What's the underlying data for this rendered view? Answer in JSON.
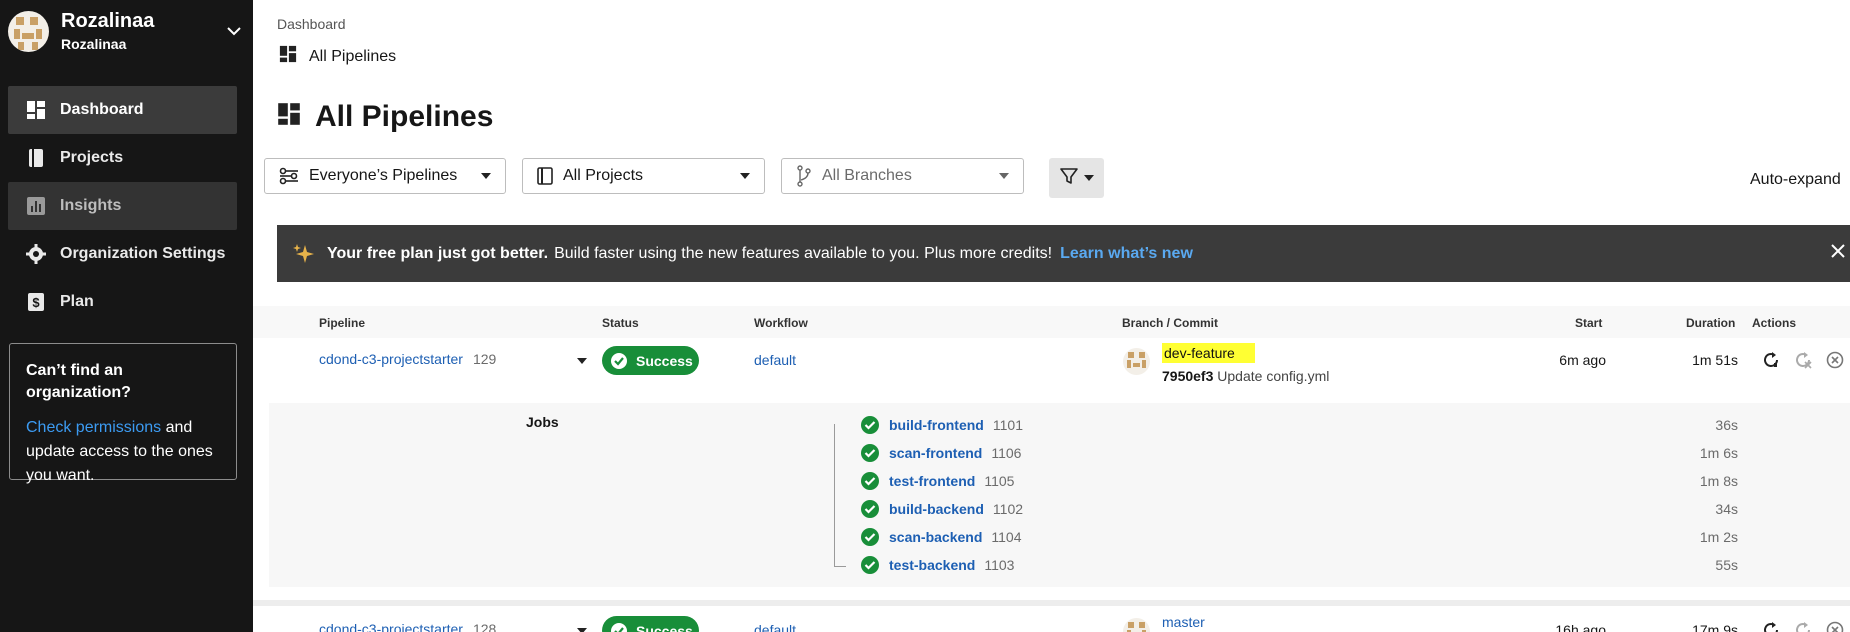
{
  "sidebar": {
    "org_name": "Rozalinaa",
    "org_sub": "Rozalinaa",
    "items": [
      {
        "label": "Dashboard",
        "icon": "dashboard-icon"
      },
      {
        "label": "Projects",
        "icon": "book-icon"
      },
      {
        "label": "Insights",
        "icon": "bar-chart-icon"
      },
      {
        "label": "Organization Settings",
        "icon": "gear-icon"
      },
      {
        "label": "Plan",
        "icon": "dollar-icon"
      }
    ],
    "help": {
      "title": "Can’t find an organization?",
      "link": "Check permissions",
      "text": " and update access to the ones you want."
    }
  },
  "header": {
    "breadcrumb": "Dashboard",
    "breadcrumb_page": "All Pipelines",
    "title": "All Pipelines"
  },
  "filters": {
    "pipelines": "Everyone’s Pipelines",
    "projects": "All Projects",
    "branches": "All Branches",
    "autoexpand": "Auto-expand"
  },
  "banner": {
    "bold": "Your free plan just got better.",
    "text": "Build faster using the new features available to you. Plus more credits!",
    "link": "Learn what’s new"
  },
  "table": {
    "headers": {
      "pipeline": "Pipeline",
      "status": "Status",
      "workflow": "Workflow",
      "branch": "Branch / Commit",
      "start": "Start",
      "duration": "Duration",
      "actions": "Actions"
    },
    "rows": [
      {
        "name": "cdond-c3-projectstarter",
        "number": "129",
        "status": "Success",
        "workflow": "default",
        "branch": "dev-feature",
        "commit_hash": "7950ef3",
        "commit_msg": "Update config.yml",
        "start": "6m ago",
        "duration": "1m 51s"
      },
      {
        "name": "cdond-c3-projectstarter",
        "number": "128",
        "status": "Success",
        "workflow": "default",
        "branch": "master",
        "start": "16h ago",
        "duration": "17m 9s"
      }
    ],
    "jobs_label": "Jobs",
    "jobs": [
      {
        "name": "build-frontend",
        "number": "1101",
        "duration": "36s"
      },
      {
        "name": "scan-frontend",
        "number": "1106",
        "duration": "1m 6s"
      },
      {
        "name": "test-frontend",
        "number": "1105",
        "duration": "1m 8s"
      },
      {
        "name": "build-backend",
        "number": "1102",
        "duration": "34s"
      },
      {
        "name": "scan-backend",
        "number": "1104",
        "duration": "1m 2s"
      },
      {
        "name": "test-backend",
        "number": "1103",
        "duration": "55s"
      }
    ]
  },
  "colors": {
    "sidebar_bg": "#161616",
    "success": "#188e39",
    "link": "#1d5fb3",
    "highlight": "#ffff33"
  }
}
